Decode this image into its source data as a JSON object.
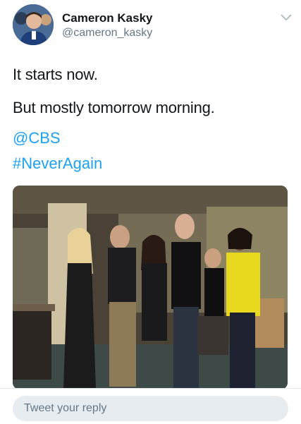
{
  "author": {
    "name": "Cameron Kasky",
    "handle": "@cameron_kasky"
  },
  "tweet": {
    "line1": "It starts now.",
    "line2": "But mostly tomorrow morning.",
    "mention": "@CBS",
    "hashtag": "#NeverAgain"
  },
  "reply": {
    "placeholder": "Tweet your reply"
  },
  "colors": {
    "link": "#1da1f2",
    "secondary_text": "#657786",
    "input_bg": "#e6ecf0"
  }
}
